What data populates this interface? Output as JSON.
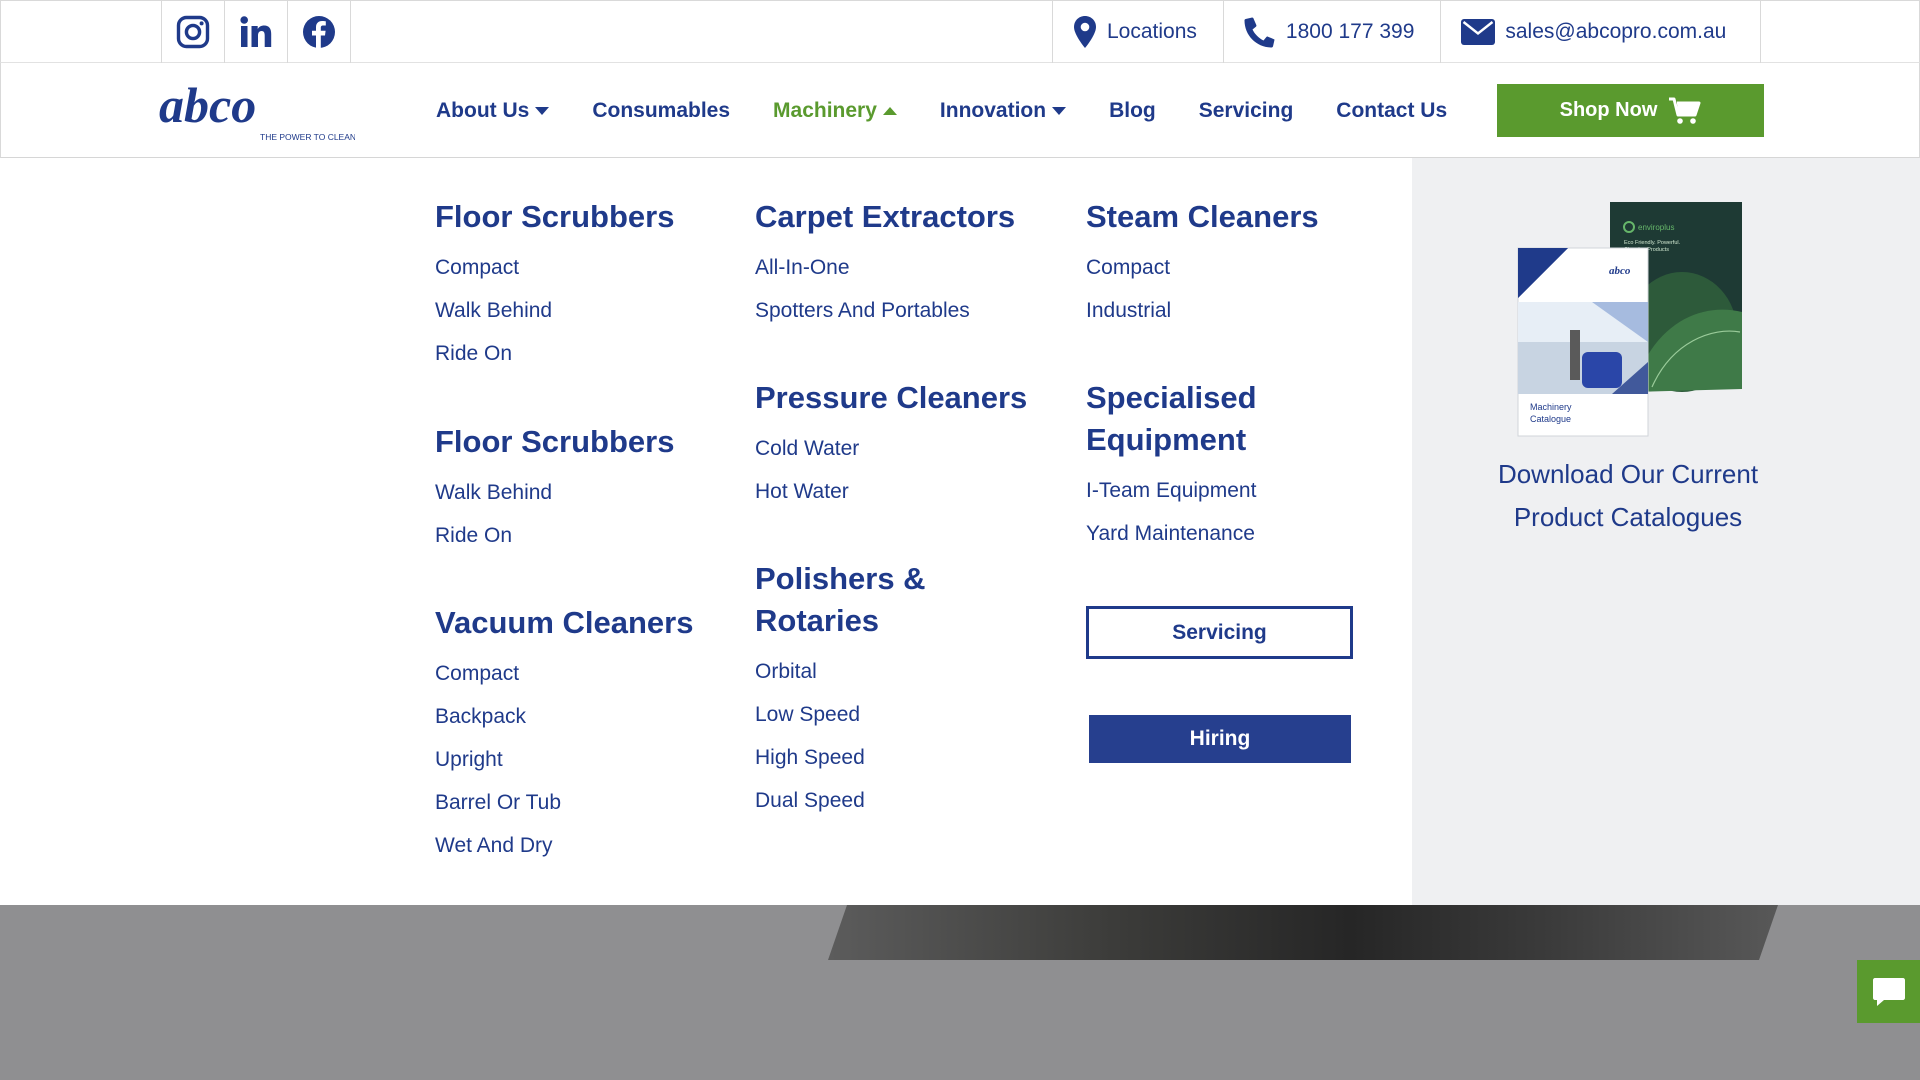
{
  "topbar": {
    "social": [
      {
        "name": "instagram-icon"
      },
      {
        "name": "linkedin-icon"
      },
      {
        "name": "facebook-icon"
      }
    ],
    "locations_label": "Locations",
    "phone": "1800 177 399",
    "email": "sales@abcopro.com.au"
  },
  "brand": {
    "logo_text": "abco",
    "tagline": "THE POWER TO CLEAN",
    "primary_color": "#1f3a8a",
    "accent_color": "#5a9a2e"
  },
  "nav": {
    "items": [
      {
        "label": "About Us",
        "dropdown": true
      },
      {
        "label": "Consumables",
        "dropdown": false
      },
      {
        "label": "Machinery",
        "dropdown": true,
        "active": true
      },
      {
        "label": "Innovation",
        "dropdown": true
      },
      {
        "label": "Blog",
        "dropdown": false
      },
      {
        "label": "Servicing",
        "dropdown": false
      },
      {
        "label": "Contact Us",
        "dropdown": false
      }
    ],
    "shop_label": "Shop Now"
  },
  "mega": {
    "col1": [
      {
        "title": "Floor Scrubbers",
        "links": [
          "Compact",
          "Walk Behind",
          "Ride On"
        ]
      },
      {
        "title": "Floor Scrubbers",
        "links": [
          "Walk Behind",
          "Ride On"
        ]
      },
      {
        "title": "Vacuum Cleaners",
        "links": [
          "Compact",
          "Backpack",
          "Upright",
          "Barrel Or Tub",
          "Wet And Dry"
        ]
      }
    ],
    "col2": [
      {
        "title": "Carpet Extractors",
        "links": [
          "All-In-One",
          "Spotters And Portables"
        ]
      },
      {
        "title": "Pressure Cleaners",
        "links": [
          "Cold Water",
          "Hot Water"
        ]
      },
      {
        "title_line1": "Polishers &",
        "title_line2": "Rotaries",
        "links": [
          "Orbital",
          "Low Speed",
          "High Speed",
          "Dual Speed"
        ]
      }
    ],
    "col3": [
      {
        "title": "Steam Cleaners",
        "links": [
          "Compact",
          "Industrial"
        ]
      },
      {
        "title_line1": "Specialised",
        "title_line2": "Equipment",
        "links": [
          "I-Team Equipment",
          "Yard Maintenance"
        ]
      }
    ],
    "servicing_button": "Servicing",
    "hiring_button": "Hiring",
    "catalogue": {
      "line1": "Download Our Current",
      "line2": "Product Catalogues",
      "front_cover_line1": "Machinery",
      "front_cover_line2": "Catalogue",
      "back_cover_brand": "enviroplus",
      "back_cover_line1": "Eco Friendly. Powerful.",
      "back_cover_line2": "Cleaning Products"
    }
  },
  "chat": {
    "icon": "chat-bubble-icon"
  }
}
